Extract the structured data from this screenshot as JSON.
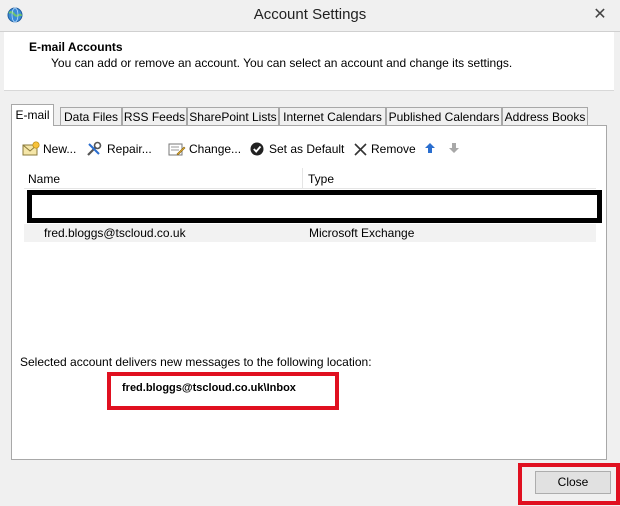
{
  "window": {
    "title": "Account Settings"
  },
  "header": {
    "title": "E-mail Accounts",
    "description": "You can add or remove an account. You can select an account and change its settings."
  },
  "tabs": [
    {
      "label": "E-mail",
      "active": true
    },
    {
      "label": "Data Files"
    },
    {
      "label": "RSS Feeds"
    },
    {
      "label": "SharePoint Lists"
    },
    {
      "label": "Internet Calendars"
    },
    {
      "label": "Published Calendars"
    },
    {
      "label": "Address Books"
    }
  ],
  "toolbar": {
    "new_label": "New...",
    "repair_label": "Repair...",
    "change_label": "Change...",
    "default_label": "Set as Default",
    "remove_label": "Remove"
  },
  "list": {
    "columns": {
      "name": "Name",
      "type": "Type"
    },
    "rows": [
      {
        "name": "fred.bloggs@tscloud.co.uk",
        "type": "Microsoft Exchange"
      }
    ]
  },
  "delivery": {
    "label": "Selected account delivers new messages to the following location:",
    "location": "fred.bloggs@tscloud.co.uk\\Inbox"
  },
  "footer": {
    "close_label": "Close"
  },
  "colors": {
    "highlight_red": "#e01020",
    "highlight_black": "#000000",
    "accent_blue": "#2a6ecf"
  }
}
